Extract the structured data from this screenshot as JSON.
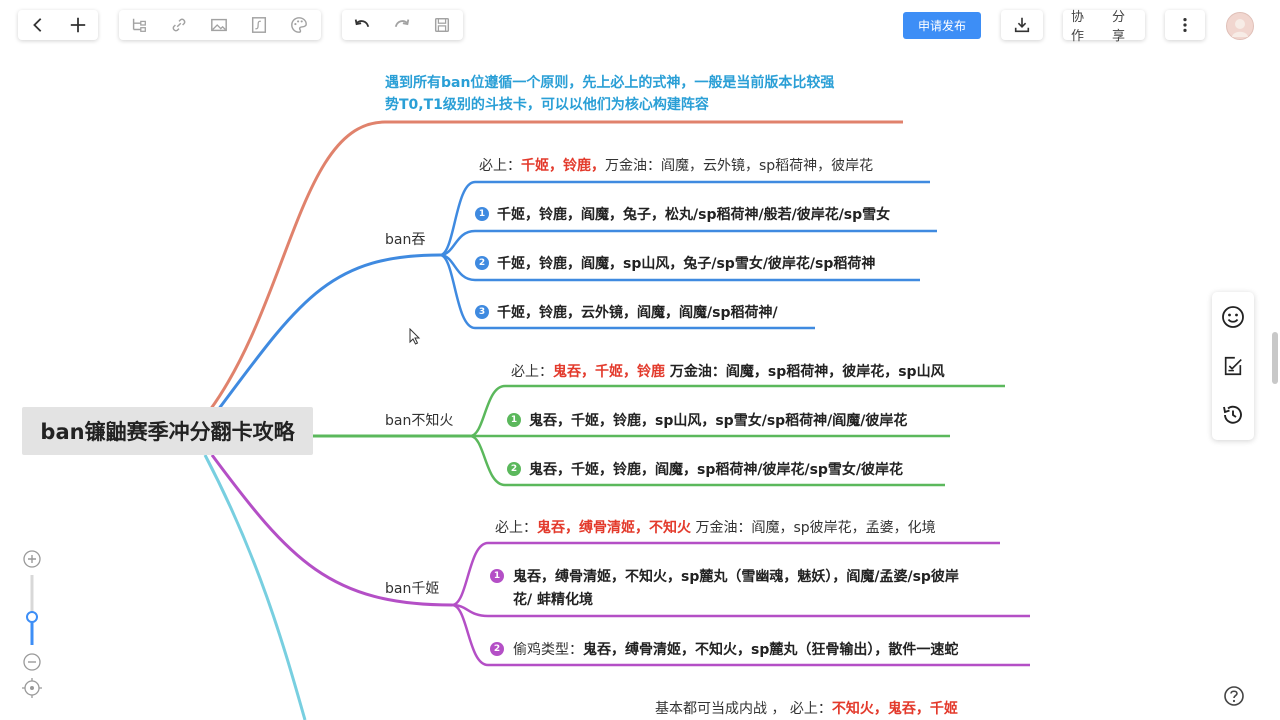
{
  "toolbar": {
    "back_icon": "chevron-left-icon",
    "add_icon": "plus-icon",
    "publish_label": "申请发布",
    "collab_label": "协作",
    "share_label": "分享"
  },
  "colors": {
    "orange": "#e0826c",
    "blue": "#3f8ae0",
    "green": "#5bb85c",
    "purple": "#b44fc6",
    "cyan": "#78cfe0",
    "red_text": "#e33a2c",
    "note_text": "#2a9fd6",
    "accent": "#3d8ef6"
  },
  "root": {
    "title": "ban镰鼬赛季冲分翻卡攻略"
  },
  "note": {
    "line1": "遇到所有ban位遵循一个原则，先上必上的式神，一般是当前版本比较强",
    "line2": "势T0,T1级别的斗技卡，可以以他们为核心构建阵容"
  },
  "branch_blue": {
    "label": "ban吞",
    "must_prefix": "必上：",
    "must_names": "千姬，铃鹿，",
    "must_rest": "万金油：阎魔，云外镜，sp稻荷神，彼岸花",
    "items": [
      {
        "num": "1",
        "text": "千姬，铃鹿，阎魔，兔子，松丸/sp稻荷神/般若/彼岸花/sp雪女"
      },
      {
        "num": "2",
        "text": "千姬，铃鹿，阎魔，sp山风，兔子/sp雪女/彼岸花/sp稻荷神"
      },
      {
        "num": "3",
        "text": "千姬，铃鹿，云外镜，阎魔，阎魔/sp稻荷神/"
      }
    ]
  },
  "branch_green": {
    "label": "ban不知火",
    "must_prefix": "必上：",
    "must_names": "鬼吞，千姬，铃鹿",
    "must_rest": " 万金油：阎魔，sp稻荷神，彼岸花，sp山风",
    "items": [
      {
        "num": "1",
        "text": "鬼吞，千姬，铃鹿，sp山风，sp雪女/sp稻荷神/阎魔/彼岸花"
      },
      {
        "num": "2",
        "text": "鬼吞，千姬，铃鹿，阎魔，sp稻荷神/彼岸花/sp雪女/彼岸花"
      }
    ]
  },
  "branch_purple": {
    "label": "ban千姬",
    "must_prefix": "必上：",
    "must_names": "鬼吞，缚骨清姬，不知火",
    "must_rest": " 万金油：阎魔，sp彼岸花，孟婆，化境",
    "items": [
      {
        "num": "1",
        "line1": "鬼吞，缚骨清姬，不知火，sp麓丸（雪幽魂，魅妖），阎魔/孟婆/sp彼岸",
        "line2": "花/ 蚌精化境"
      },
      {
        "num": "2",
        "prefix": "偷鸡类型：",
        "text": "鬼吞，缚骨清姬，不知火，sp麓丸（狂骨输出），散件一速蛇"
      }
    ]
  },
  "branch_cyan": {
    "prefix": "基本都可当成内战 ，  必上：",
    "names": "不知火，鬼吞，千姬"
  },
  "side_panel": [
    "smile-icon",
    "edit-note-icon",
    "history-icon"
  ],
  "zoom": [
    "zoom-in-icon",
    "zoom-out-icon",
    "locate-icon"
  ],
  "help_icon": "help-icon"
}
